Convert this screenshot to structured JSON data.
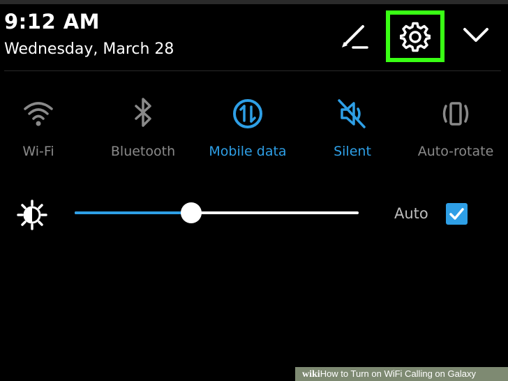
{
  "status": {
    "time": "9:12 AM",
    "date": "Wednesday, March 28"
  },
  "header_icons": {
    "edit": "pencil-icon",
    "settings": "gear-icon",
    "collapse": "chevron-down-icon",
    "highlight_color": "#39ff14"
  },
  "quick_tiles": [
    {
      "label": "Wi-Fi",
      "icon": "wifi-icon",
      "active": false
    },
    {
      "label": "Bluetooth",
      "icon": "bluetooth-icon",
      "active": false
    },
    {
      "label": "Mobile data",
      "icon": "mobile-data-icon",
      "active": true
    },
    {
      "label": "Silent",
      "icon": "silent-icon",
      "active": true
    },
    {
      "label": "Auto-rotate",
      "icon": "auto-rotate-icon",
      "active": false
    }
  ],
  "brightness": {
    "icon": "brightness-icon",
    "level_percent": 41,
    "auto_label": "Auto",
    "auto_checked": true
  },
  "colors": {
    "accent": "#2e9fe6",
    "inactive": "#8a8a8a",
    "background": "#000000"
  },
  "watermark": {
    "brand": "wiki",
    "text": "How to Turn on WiFi Calling on Galaxy"
  }
}
